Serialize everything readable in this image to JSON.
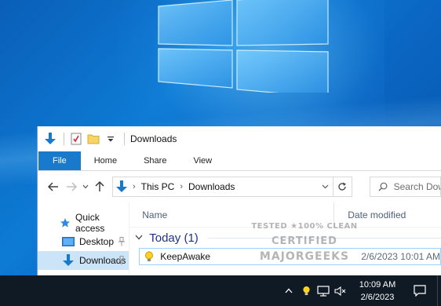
{
  "window": {
    "title": "Downloads",
    "ribbon_tabs": [
      "File",
      "Home",
      "Share",
      "View"
    ]
  },
  "address": {
    "crumbs": [
      "This PC",
      "Downloads"
    ],
    "search_placeholder": "Search Downloads"
  },
  "nav_pane": {
    "quick_access": "Quick access",
    "items": [
      {
        "label": "Desktop",
        "pinned": true,
        "selected": false
      },
      {
        "label": "Downloads",
        "pinned": true,
        "selected": true
      }
    ]
  },
  "columns": {
    "name": "Name",
    "date_modified": "Date modified"
  },
  "groups": [
    {
      "label": "Today (1)",
      "files": [
        {
          "name": "KeepAwake",
          "date": "2/6/2023 10:01 AM"
        }
      ]
    }
  ],
  "watermark": {
    "line1": "TESTED ★100% CLEAN",
    "line2": "CERTIFIED",
    "line3": "MAJORGEEKS"
  },
  "taskbar": {
    "time": "10:09 AM",
    "date": "2/6/2023"
  },
  "colors": {
    "file_tab": "#1979ca",
    "selection": "#cce4f7",
    "taskbar": "#101a24",
    "group_header": "#1e3287"
  }
}
